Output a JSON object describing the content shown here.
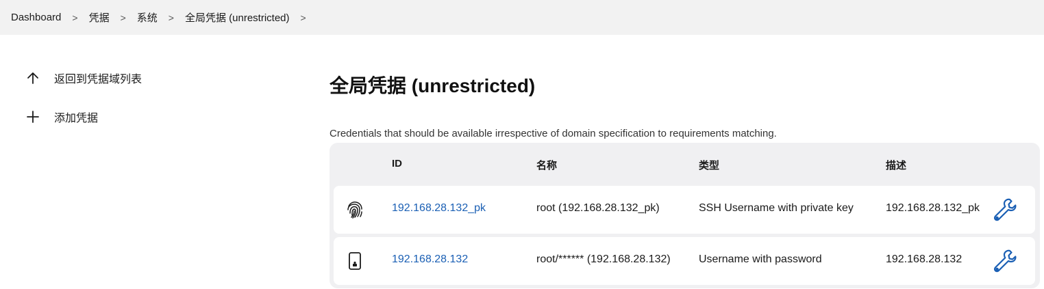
{
  "breadcrumb": {
    "items": [
      "Dashboard",
      "凭据",
      "系统",
      "全局凭据 (unrestricted)"
    ],
    "separator": ">"
  },
  "sidebar": {
    "items": [
      {
        "label": "返回到凭据域列表",
        "icon": "arrow-up-icon"
      },
      {
        "label": "添加凭据",
        "icon": "plus-icon"
      }
    ]
  },
  "page": {
    "title": "全局凭据 (unrestricted)",
    "description": "Credentials that should be available irrespective of domain specification to requirements matching."
  },
  "table": {
    "headers": {
      "id": "ID",
      "name": "名称",
      "type": "类型",
      "desc": "描述"
    },
    "rows": [
      {
        "icon": "fingerprint-icon",
        "id": "192.168.28.132_pk",
        "name": "root (192.168.28.132_pk)",
        "type": "SSH Username with private key",
        "desc": "192.168.28.132_pk"
      },
      {
        "icon": "phone-icon",
        "id": "192.168.28.132",
        "name": "root/****** (192.168.28.132)",
        "type": "Username with password",
        "desc": "192.168.28.132"
      }
    ]
  },
  "colors": {
    "link": "#1a5fb4",
    "accent_icon": "#1a5fb4",
    "header_bg": "#f2f2f2"
  }
}
